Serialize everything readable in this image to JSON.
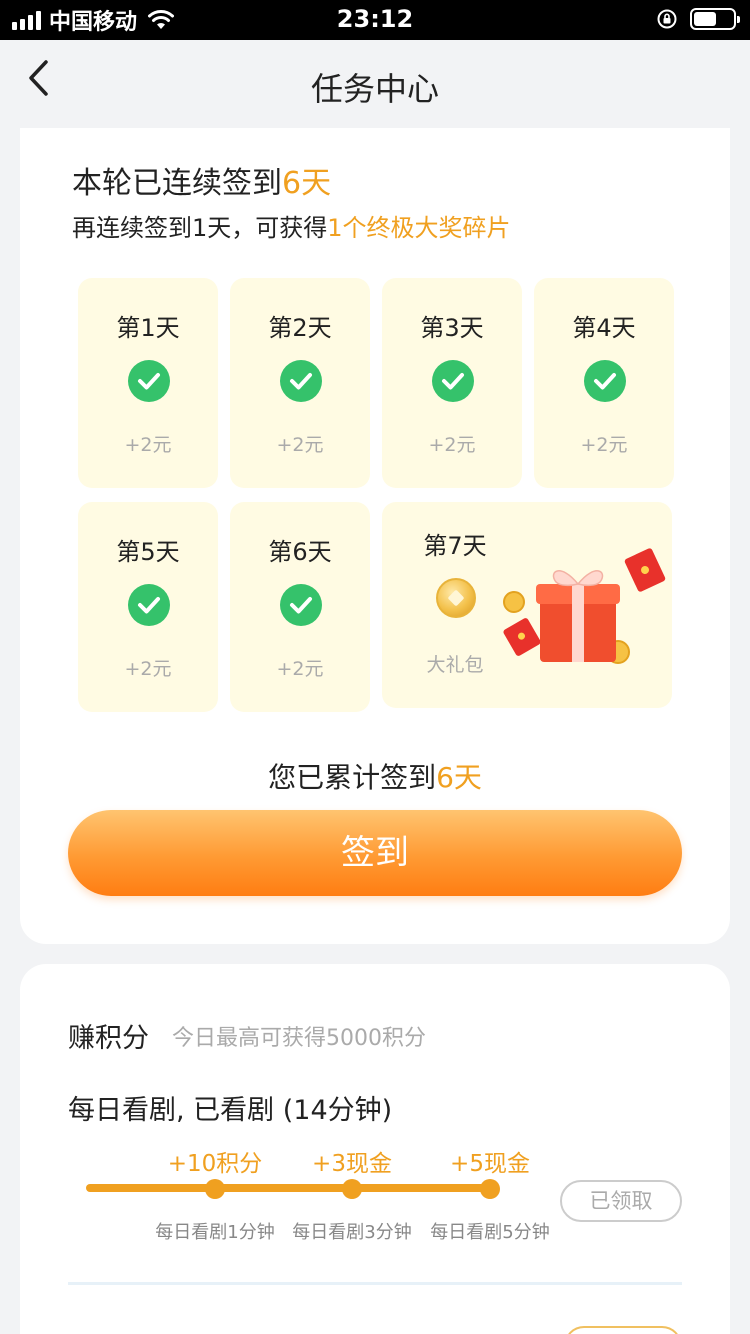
{
  "status_bar": {
    "carrier": "中国移动",
    "time": "23:12"
  },
  "nav": {
    "title": "任务中心"
  },
  "checkin": {
    "streak_prefix": "本轮已连续签到",
    "streak_value": "6天",
    "hint_prefix": "再连续签到1天，可获得",
    "hint_highlight": "1个终极大奖碎片",
    "days": [
      {
        "label": "第1天",
        "reward": "+2元",
        "checked": true
      },
      {
        "label": "第2天",
        "reward": "+2元",
        "checked": true
      },
      {
        "label": "第3天",
        "reward": "+2元",
        "checked": true
      },
      {
        "label": "第4天",
        "reward": "+2元",
        "checked": true
      },
      {
        "label": "第5天",
        "reward": "+2元",
        "checked": true
      },
      {
        "label": "第6天",
        "reward": "+2元",
        "checked": true
      }
    ],
    "day7": {
      "label": "第7天",
      "reward": "大礼包"
    },
    "cumulative_prefix": "您已累计签到",
    "cumulative_value": "6天",
    "button_label": "签到"
  },
  "points": {
    "title": "赚积分",
    "subtitle": "今日最高可获得5000积分",
    "watch_title": "每日看剧, 已看剧 (14分钟)",
    "milestones": [
      {
        "reward": "+10积分",
        "caption": "每日看剧1分钟"
      },
      {
        "reward": "+3现金",
        "caption": "每日看剧3分钟"
      },
      {
        "reward": "+5现金",
        "caption": "每日看剧5分钟"
      }
    ],
    "claimed_label": "已领取"
  },
  "colors": {
    "accent": "#f0a020",
    "check_green": "#35c26b",
    "day_bg": "#fffbe3",
    "button_orange": "#ff8a1f"
  }
}
